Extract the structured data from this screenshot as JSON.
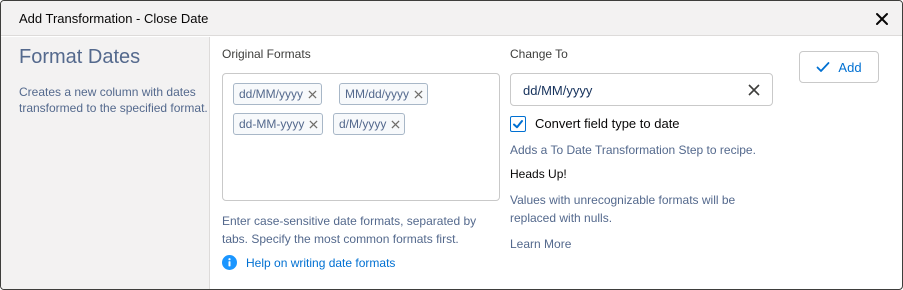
{
  "header": {
    "title": "Add Transformation - Close Date"
  },
  "sidebar": {
    "title": "Format Dates",
    "description": "Creates a new column with dates transformed to the specified format."
  },
  "original_formats": {
    "label": "Original Formats",
    "pills": [
      "dd/MM/yyyy",
      "MM/dd/yyyy",
      "dd-MM-yyyy",
      "d/M/yyyy"
    ],
    "hint": "Enter case-sensitive date formats, separated by tabs. Specify the most common formats first.",
    "help_link": "Help on writing date formats"
  },
  "change_to": {
    "label": "Change To",
    "value": "dd/MM/yyyy",
    "convert_checkbox": {
      "label": "Convert field type to date",
      "checked": true
    },
    "convert_note": "Adds a To Date Transformation Step to recipe.",
    "heads_up_title": "Heads Up!",
    "heads_up_text": "Values with unrecognizable formats will be replaced with nulls.",
    "learn_more": "Learn More"
  },
  "actions": {
    "add_label": "Add"
  },
  "colors": {
    "brand": "#0070d2",
    "text_weak": "#54698d",
    "info": "#1b96ff"
  }
}
